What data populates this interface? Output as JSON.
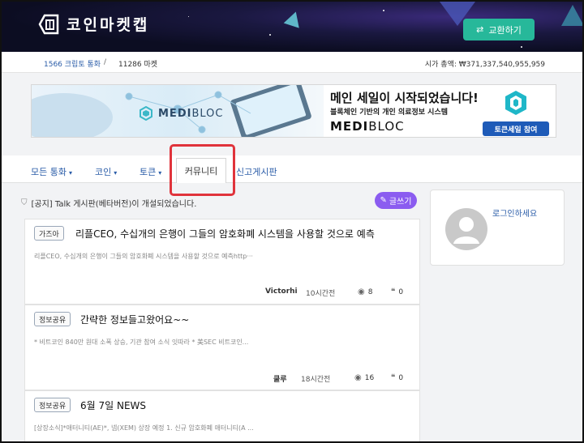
{
  "header": {
    "logo_text": "코인마켓캡",
    "exchange_button": "교환하기"
  },
  "stats": {
    "coins": "1566 크립토 통화",
    "separator": "/",
    "markets": "11286 마켓",
    "market_cap": "시가 총액: ₩371,337,540,955,959"
  },
  "banner": {
    "title": "메인 세일이 시작되었습니다!",
    "subtitle": "블록체인 기반의 개인 의료정보 시스템",
    "brand_left": "MEDI",
    "brand_right": "BLOC",
    "logo_left": "MEDI",
    "logo_right": "BLOC",
    "cta": "토큰세일 참여"
  },
  "nav": {
    "items": [
      {
        "label": "모든 통화",
        "caret": "▾"
      },
      {
        "label": "코인",
        "caret": "▾"
      },
      {
        "label": "토큰",
        "caret": "▾"
      },
      {
        "label": "커뮤니티"
      },
      {
        "label": "신고게시판"
      }
    ]
  },
  "notice": {
    "text": "[공지] Talk 게시판(베타버전)이 개설되었습니다.",
    "write_button": "글쓰기"
  },
  "posts": [
    {
      "tag": "가즈아",
      "title": "리플CEO, 수십개의 은행이 그들의 암호화폐 시스템을 사용할 것으로 예측",
      "excerpt": "리플CEO, 수십개의 은행이 그들의 암호화폐 시스템을 사용할 것으로 예측http···",
      "author": "Victorhi",
      "time": "10시간전",
      "views": "8",
      "comments": "0"
    },
    {
      "tag": "정보공유",
      "title": "간략한 정보들고왔어요~~",
      "excerpt": "* 비트코인 840만 원대 소폭 상승, 기관 참여 소식 잇따라 * 美SEC 비트코인...",
      "author": "쿨루",
      "time": "18시간전",
      "views": "16",
      "comments": "0"
    },
    {
      "tag": "정보공유",
      "title": "6월 7일 NEWS",
      "excerpt": "[상장소식]*애터니티(AE)*, 넴(XEM) 상장 예정 1. 신규 암호화폐 애터니티(A ..."
    }
  ],
  "sidebar": {
    "login_text": "로그인하세요"
  },
  "colors": {
    "accent_green": "#27b89a",
    "link_blue": "#2a5ca8",
    "write_purple": "#8b5cf0",
    "highlight_red": "#e0333b",
    "cta_blue": "#1e5bb8"
  }
}
